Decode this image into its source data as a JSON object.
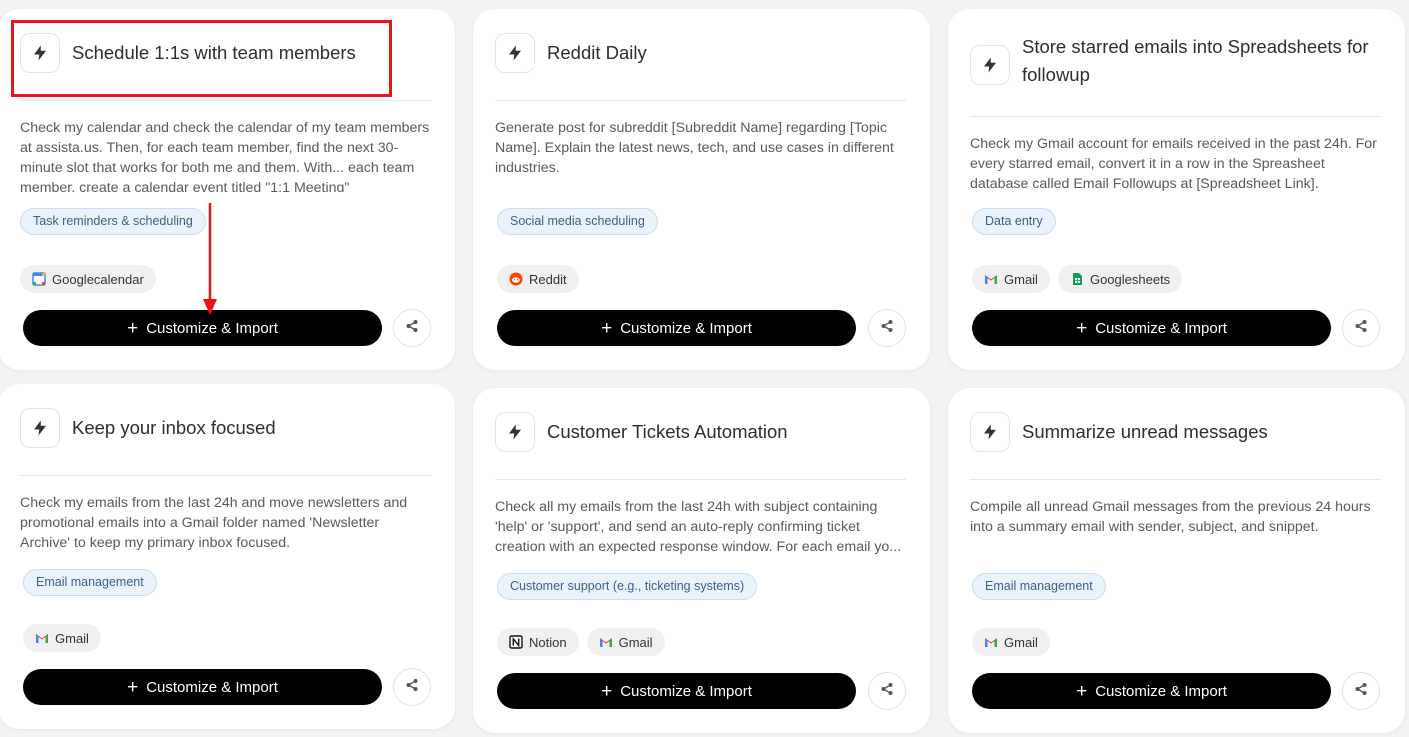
{
  "cards": [
    {
      "title": "Schedule 1:1s with team members",
      "description": "Check my calendar and check the calendar of my team members at assista.us. Then, for each team member, find the next 30-minute slot that works for both me and them. With... each team member, create a calendar event titled \"1:1 Meeting\"",
      "tag": "Task reminders & scheduling",
      "apps": [
        "Googlecalendar"
      ],
      "cta": "Customize & Import"
    },
    {
      "title": "Reddit Daily",
      "description": "Generate post for subreddit [Subreddit Name] regarding [Topic Name]. Explain the latest news, tech, and use cases in different industries.",
      "tag": "Social media scheduling",
      "apps": [
        "Reddit"
      ],
      "cta": "Customize & Import"
    },
    {
      "title": "Store starred emails into Spreadsheets for followup",
      "description": "Check my Gmail account for emails received in the past 24h. For every starred email, convert it in a row in the Spreasheet database called Email Followups at [Spreadsheet Link].",
      "tag": "Data entry",
      "apps": [
        "Gmail",
        "Googlesheets"
      ],
      "cta": "Customize & Import"
    },
    {
      "title": "Keep your inbox focused",
      "description": "Check my emails from the last 24h and move newsletters and promotional emails into a Gmail folder named 'Newsletter Archive' to keep my primary inbox focused.",
      "tag": "Email management",
      "apps": [
        "Gmail"
      ],
      "cta": "Customize & Import"
    },
    {
      "title": "Customer Tickets Automation",
      "description": "Check all my emails from the last 24h with subject containing 'help' or 'support', and send an auto-reply confirming ticket creation with an expected response window. For each email yo...",
      "tag": "Customer support (e.g., ticketing systems)",
      "apps": [
        "Notion",
        "Gmail"
      ],
      "cta": "Customize & Import"
    },
    {
      "title": "Summarize unread messages",
      "description": "Compile all unread Gmail messages from the previous 24 hours into a summary email with sender, subject, and snippet.",
      "tag": "Email management",
      "apps": [
        "Gmail"
      ],
      "cta": "Customize & Import"
    }
  ],
  "colors": {
    "highlight": "#e8131b",
    "tag_bg": "#eaf2fc",
    "cta_bg": "#000000"
  }
}
